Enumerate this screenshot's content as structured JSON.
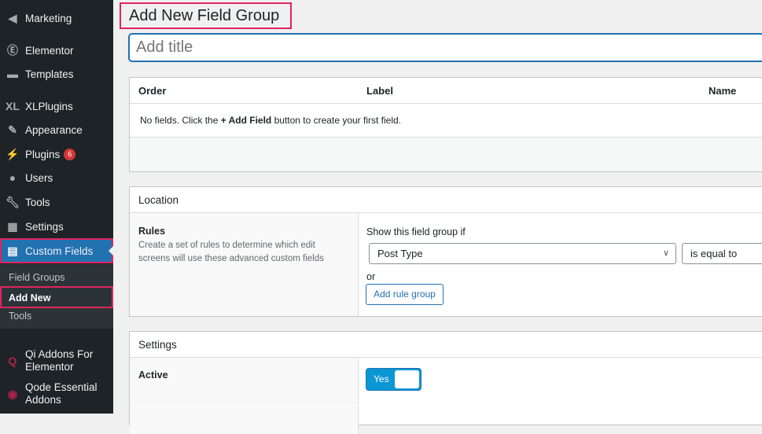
{
  "sidebar": {
    "items": [
      {
        "label": "Marketing",
        "icon": "megaphone-icon"
      },
      {
        "label": "Elementor",
        "icon": "elementor-icon"
      },
      {
        "label": "Templates",
        "icon": "folder-icon"
      },
      {
        "label": "XLPlugins",
        "icon": "xl-icon"
      },
      {
        "label": "Appearance",
        "icon": "paintbrush-icon"
      },
      {
        "label": "Plugins",
        "icon": "plugin-icon",
        "badge": "6"
      },
      {
        "label": "Users",
        "icon": "user-icon"
      },
      {
        "label": "Tools",
        "icon": "wrench-icon"
      },
      {
        "label": "Settings",
        "icon": "settings-icon"
      },
      {
        "label": "Custom Fields",
        "icon": "table-icon"
      },
      {
        "label": "Qi Addons For Elementor",
        "icon": "qi-icon"
      },
      {
        "label": "Qode Essential Addons",
        "icon": "qode-icon"
      }
    ],
    "submenu": [
      "Field Groups",
      "Add New",
      "Tools"
    ]
  },
  "page": {
    "title": "Add New Field Group",
    "title_placeholder": "Add title"
  },
  "fields": {
    "columns": [
      "Order",
      "Label",
      "Name"
    ],
    "empty_pre": "No fields. Click the ",
    "empty_btn": "+ Add Field",
    "empty_post": " button to create your first field."
  },
  "location": {
    "heading": "Location",
    "rules_label": "Rules",
    "rules_desc": "Create a set of rules to determine which edit screens will use these advanced custom fields",
    "show_if": "Show this field group if",
    "param": "Post Type",
    "operator": "is equal to",
    "or": "or",
    "add_rule_group": "Add rule group"
  },
  "settings": {
    "heading": "Settings",
    "active_label": "Active",
    "active_value": "Yes",
    "active_on": true
  },
  "colors": {
    "accent": "#2271b1",
    "highlight": "#e0245e",
    "toggle": "#0b96d4"
  }
}
